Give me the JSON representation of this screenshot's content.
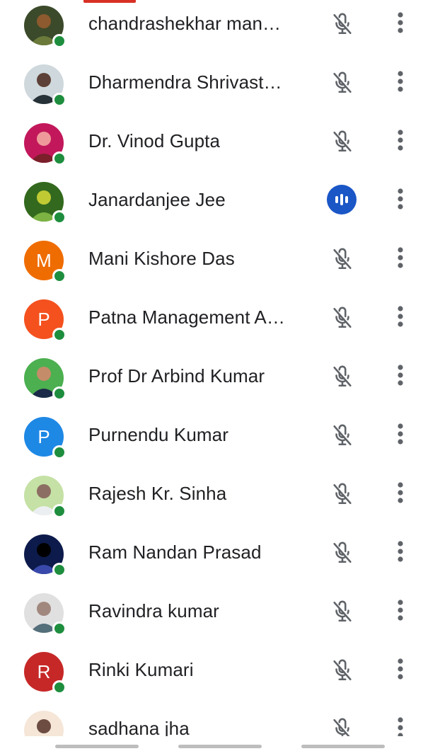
{
  "participants": [
    {
      "name": "chandrashekhar man…",
      "avatar": {
        "kind": "photo",
        "palette": [
          "#3b4a2a",
          "#6b7a3a",
          "#8c5a2e"
        ]
      },
      "online": true,
      "audio": "muted"
    },
    {
      "name": "Dharmendra Shrivast…",
      "avatar": {
        "kind": "photo",
        "palette": [
          "#cfd8dc",
          "#263238",
          "#5d4037"
        ]
      },
      "online": true,
      "audio": "muted"
    },
    {
      "name": "Dr. Vinod Gupta",
      "avatar": {
        "kind": "photo",
        "palette": [
          "#c2185b",
          "#7b1f2b",
          "#ef9a9a"
        ]
      },
      "online": true,
      "audio": "muted"
    },
    {
      "name": "Janardanjee Jee",
      "avatar": {
        "kind": "photo",
        "palette": [
          "#33691e",
          "#7cb342",
          "#c0ca33"
        ]
      },
      "online": true,
      "audio": "speaking"
    },
    {
      "name": "Mani Kishore Das",
      "avatar": {
        "kind": "initial",
        "letter": "M",
        "color": "#ef6c00"
      },
      "online": true,
      "audio": "muted"
    },
    {
      "name": "Patna Management A…",
      "avatar": {
        "kind": "initial",
        "letter": "P",
        "color": "#f4511e"
      },
      "online": true,
      "audio": "muted"
    },
    {
      "name": "Prof Dr Arbind Kumar",
      "avatar": {
        "kind": "photo",
        "palette": [
          "#4caf50",
          "#1b2a49",
          "#c58c6a"
        ]
      },
      "online": true,
      "audio": "muted"
    },
    {
      "name": "Purnendu Kumar",
      "avatar": {
        "kind": "initial",
        "letter": "P",
        "color": "#1e88e5"
      },
      "online": true,
      "audio": "muted"
    },
    {
      "name": "Rajesh Kr. Sinha",
      "avatar": {
        "kind": "photo",
        "palette": [
          "#c5e1a5",
          "#eceff1",
          "#8d6e63"
        ]
      },
      "online": true,
      "audio": "muted"
    },
    {
      "name": "Ram Nandan Prasad",
      "avatar": {
        "kind": "photo",
        "palette": [
          "#0d1b4c",
          "#3949ab",
          "#000000"
        ]
      },
      "online": true,
      "audio": "muted"
    },
    {
      "name": "Ravindra kumar",
      "avatar": {
        "kind": "photo",
        "palette": [
          "#e0e0e0",
          "#546e7a",
          "#a1887f"
        ]
      },
      "online": true,
      "audio": "muted"
    },
    {
      "name": "Rinki Kumari",
      "avatar": {
        "kind": "initial",
        "letter": "R",
        "color": "#c62828"
      },
      "online": true,
      "audio": "muted"
    },
    {
      "name": "sadhana jha",
      "avatar": {
        "kind": "photo",
        "palette": [
          "#f5e6d8",
          "#c48a6a",
          "#6d4c41"
        ]
      },
      "online": false,
      "audio": "muted"
    }
  ],
  "icons": {
    "muted": "mic-off-icon",
    "speaking": "audio-level-icon",
    "more": "more-vert-icon"
  },
  "colors": {
    "online": "#1e8e3e",
    "speaking": "#1a56c6",
    "text": "#202124",
    "icon": "#5f6368",
    "tab_indicator": "#d93025"
  }
}
